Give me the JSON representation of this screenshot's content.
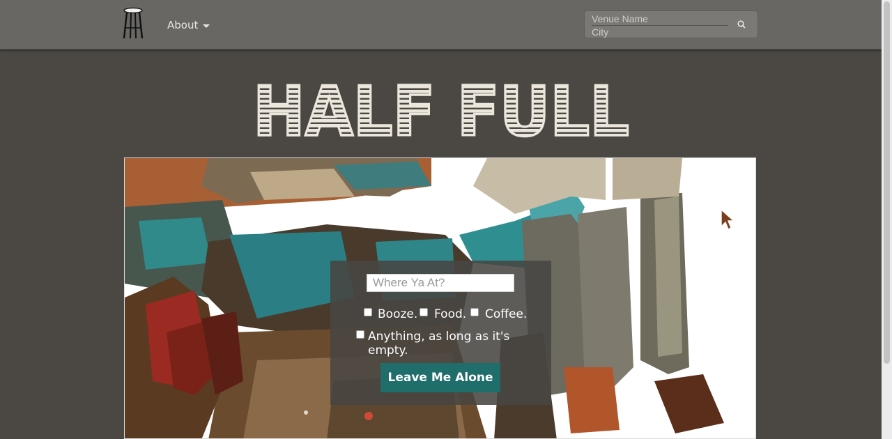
{
  "nav": {
    "about_label": "About",
    "venue_placeholder": "Venue Name",
    "city_placeholder": "City",
    "search_icon": "search-icon",
    "logo_icon": "bar-stool-icon"
  },
  "hero": {
    "title": "HALF FULL",
    "title_color": "#ece7dc"
  },
  "search_panel": {
    "where_placeholder": "Where Ya At?",
    "options": {
      "booze": "Booze.",
      "food": "Food.",
      "coffee": "Coffee.",
      "anything": "Anything, as long as it's empty."
    },
    "button_label": "Leave Me Alone"
  },
  "colors": {
    "background": "#4b4742",
    "navbar": "#686763",
    "button": "#1f6e6b"
  }
}
